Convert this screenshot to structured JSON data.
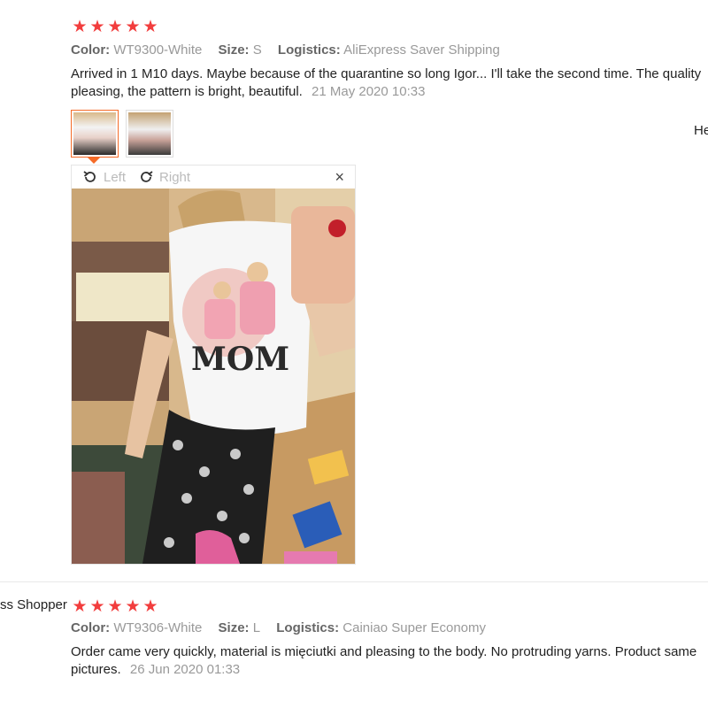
{
  "review1": {
    "stars": 5,
    "color_label": "Color:",
    "color_value": "WT9300-White",
    "size_label": "Size:",
    "size_value": "S",
    "logistics_label": "Logistics:",
    "logistics_value": "AliExpress Saver Shipping",
    "text_line1": "Arrived in 1 M10 days. Maybe because of the quarantine so long Igor... I'll take the second time. The quality",
    "text_line2": "pleasing, the pattern is bright, beautiful.",
    "date": "21 May 2020 10:33",
    "helpful_text": "He",
    "viewer": {
      "left_label": "Left",
      "right_label": "Right",
      "close_label": "×"
    },
    "photo_text": "MOM"
  },
  "review2": {
    "user": "ss Shopper",
    "stars": 5,
    "color_label": "Color:",
    "color_value": "WT9306-White",
    "size_label": "Size:",
    "size_value": "L",
    "logistics_label": "Logistics:",
    "logistics_value": "Cainiao Super Economy",
    "text_line1": "Order came very quickly, material is mięciutki and pleasing to the body. No protruding yarns. Product same",
    "text_line2": "pictures.",
    "date": "26 Jun 2020 01:33"
  },
  "colors": {
    "star": "#f23d3d",
    "accent": "#f56b28"
  }
}
